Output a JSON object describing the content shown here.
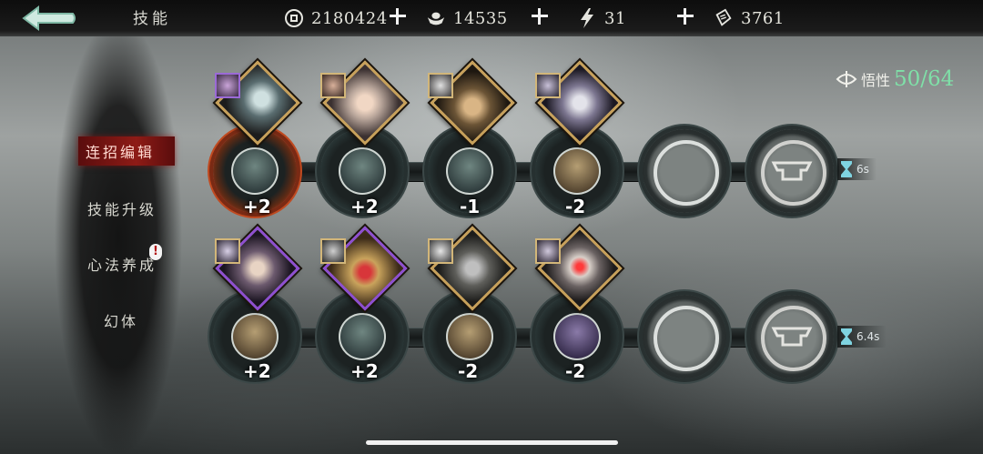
{
  "header": {
    "title": "技能",
    "resources": [
      {
        "icon": "coin-icon",
        "value": "2180424"
      },
      {
        "icon": "silver-ingot-icon",
        "value": "14535"
      },
      {
        "icon": "lightning-icon",
        "value": "31"
      },
      {
        "icon": "ticket-icon",
        "value": "3761"
      }
    ]
  },
  "sidebar": {
    "items": [
      {
        "label": "连招编辑",
        "active": true
      },
      {
        "label": "技能升级",
        "active": false
      },
      {
        "label": "心法养成",
        "active": false,
        "badge": "!"
      },
      {
        "label": "幻体",
        "active": false
      }
    ]
  },
  "enlightenment": {
    "label": "悟性",
    "current": "50",
    "separator": "/",
    "max": "64",
    "color": "#7fe0a8"
  },
  "combos": [
    {
      "timer": "6s",
      "skills": [
        {
          "cost": "+2",
          "frame": "gold",
          "highlighted": true
        },
        {
          "cost": "+2",
          "frame": "gold"
        },
        {
          "cost": "-1",
          "frame": "gold"
        },
        {
          "cost": "-2",
          "frame": "gold"
        }
      ]
    },
    {
      "timer": "6.4s",
      "skills": [
        {
          "cost": "+2",
          "frame": "purple"
        },
        {
          "cost": "+2",
          "frame": "purple"
        },
        {
          "cost": "-2",
          "frame": "gold"
        },
        {
          "cost": "-2",
          "frame": "gold"
        }
      ]
    }
  ],
  "colors": {
    "accent_red": "#8e1b16",
    "gold_frame": "#c7a05a",
    "purple_frame": "#8e4fcf"
  }
}
